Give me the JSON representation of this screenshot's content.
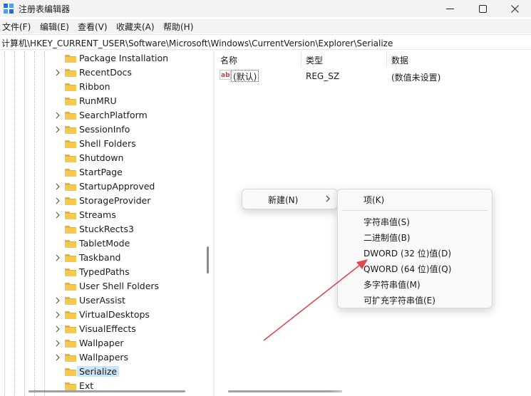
{
  "window": {
    "title": "注册表编辑器",
    "minimize_icon": "minimize-icon",
    "maximize_icon": "maximize-icon",
    "close_icon": "close-icon"
  },
  "menu": [
    {
      "label": "文件(F)"
    },
    {
      "label": "编辑(E)"
    },
    {
      "label": "查看(V)"
    },
    {
      "label": "收藏夹(A)"
    },
    {
      "label": "帮助(H)"
    }
  ],
  "address": "计算机\\HKEY_CURRENT_USER\\Software\\Microsoft\\Windows\\CurrentVersion\\Explorer\\Serialize",
  "tree": {
    "items": [
      {
        "label": "Package Installation",
        "expandable": false
      },
      {
        "label": "RecentDocs",
        "expandable": true
      },
      {
        "label": "Ribbon",
        "expandable": false
      },
      {
        "label": "RunMRU",
        "expandable": false
      },
      {
        "label": "SearchPlatform",
        "expandable": true
      },
      {
        "label": "SessionInfo",
        "expandable": true
      },
      {
        "label": "Shell Folders",
        "expandable": false
      },
      {
        "label": "Shutdown",
        "expandable": false
      },
      {
        "label": "StartPage",
        "expandable": false
      },
      {
        "label": "StartupApproved",
        "expandable": true
      },
      {
        "label": "StorageProvider",
        "expandable": true
      },
      {
        "label": "Streams",
        "expandable": true
      },
      {
        "label": "StuckRects3",
        "expandable": false
      },
      {
        "label": "TabletMode",
        "expandable": false
      },
      {
        "label": "Taskband",
        "expandable": true
      },
      {
        "label": "TypedPaths",
        "expandable": false
      },
      {
        "label": "User Shell Folders",
        "expandable": false
      },
      {
        "label": "UserAssist",
        "expandable": true
      },
      {
        "label": "VirtualDesktops",
        "expandable": true
      },
      {
        "label": "VisualEffects",
        "expandable": true
      },
      {
        "label": "Wallpaper",
        "expandable": true
      },
      {
        "label": "Wallpapers",
        "expandable": true
      },
      {
        "label": "Serialize",
        "expandable": false,
        "selected": true
      },
      {
        "label": "Ext",
        "expandable": false
      }
    ]
  },
  "list": {
    "columns": [
      "名称",
      "类型",
      "数据"
    ],
    "rows": [
      {
        "name": "(默认)",
        "type": "REG_SZ",
        "data": "(数值未设置)",
        "icon": "string-value-icon"
      }
    ]
  },
  "context_menu": {
    "new_label": "新建(N)",
    "submenu": [
      {
        "label": "项(K)"
      },
      {
        "label": "字符串值(S)"
      },
      {
        "label": "二进制值(B)"
      },
      {
        "label": "DWORD (32 位)值(D)"
      },
      {
        "label": "QWORD (64 位)值(Q)"
      },
      {
        "label": "多字符串值(M)"
      },
      {
        "label": "可扩充字符串值(E)"
      }
    ]
  },
  "colors": {
    "folder": "#f7c94b",
    "selection": "#cce4f7",
    "annotation_arrow": "#e0474a"
  }
}
